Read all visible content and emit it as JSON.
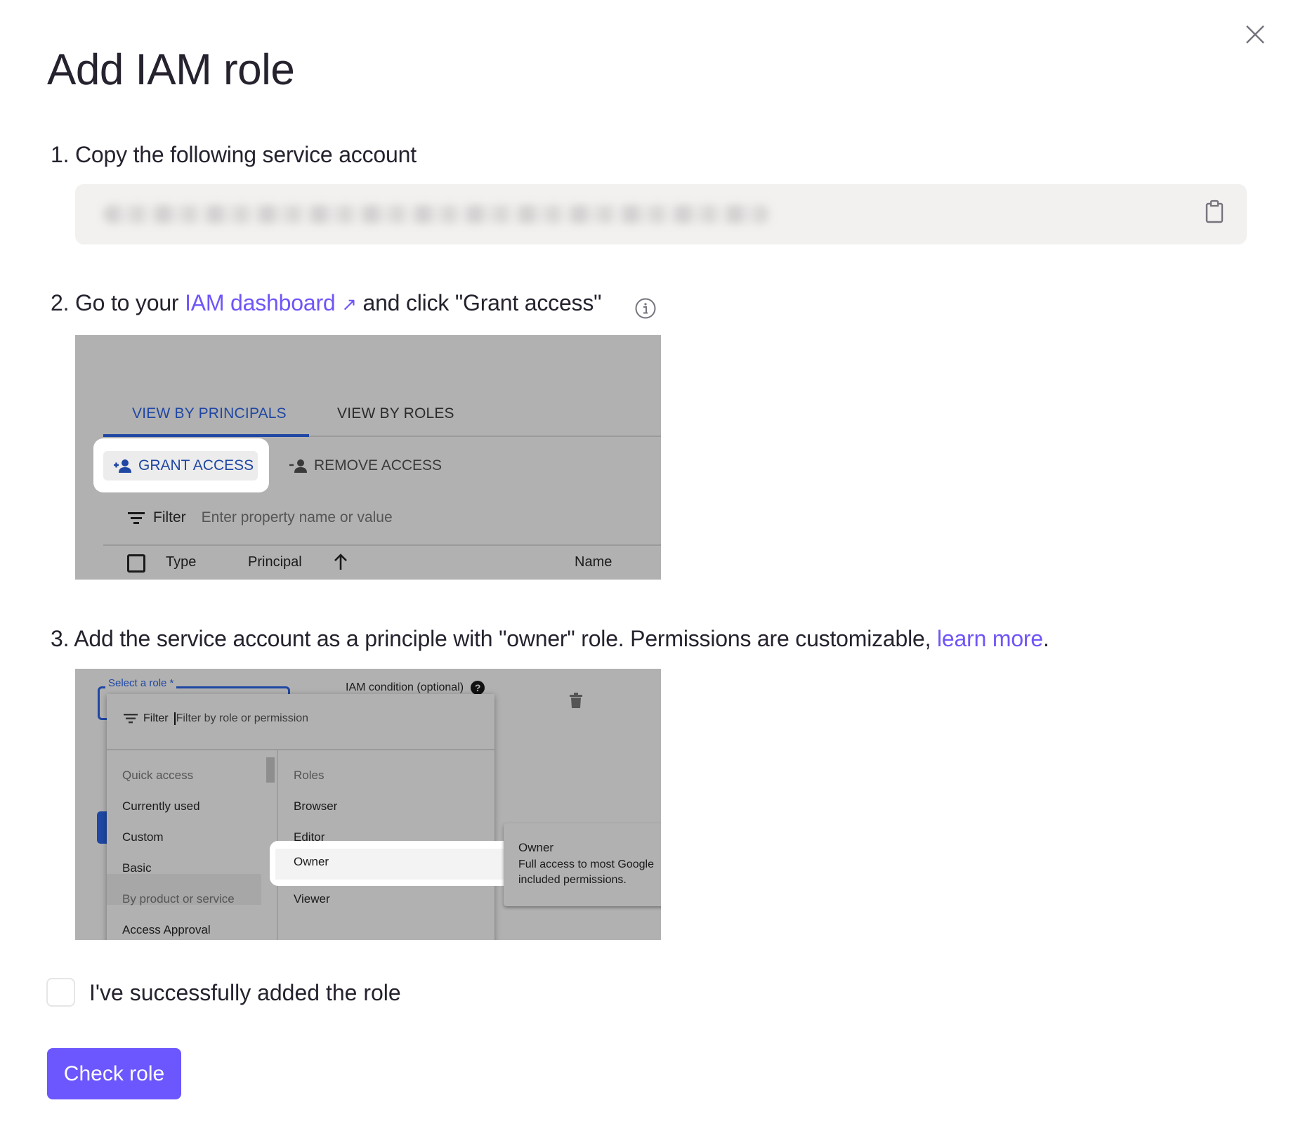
{
  "dialog": {
    "title": "Add IAM role",
    "close_icon": "close-icon"
  },
  "colors": {
    "accent": "#6b57fd",
    "link": "#6e56f8",
    "text": "#26222e",
    "gcp_blue": "#1f47a3"
  },
  "step1": {
    "text": "1. Copy the following service account",
    "service_account_value": "[blurred]",
    "copy_icon": "clipboard-icon"
  },
  "step2": {
    "prefix": "2. Go to your ",
    "link_text": "IAM dashboard",
    "link_icon": "↗",
    "suffix": " and click \"Grant access\"",
    "info_icon": "info-icon",
    "screenshot": {
      "tabs": [
        "VIEW BY PRINCIPALS",
        "VIEW BY ROLES"
      ],
      "active_tab": "VIEW BY PRINCIPALS",
      "grant_access_label": "GRANT ACCESS",
      "remove_access_label": "REMOVE ACCESS",
      "filter_label": "Filter",
      "filter_placeholder": "Enter property name or value",
      "columns": {
        "type": "Type",
        "principal": "Principal",
        "name": "Name"
      }
    }
  },
  "step3": {
    "prefix": "3. Add the service account as a principle with \"owner\" role. Permissions are customizable, ",
    "link_text": "learn more",
    "suffix": ".",
    "screenshot": {
      "select_label": "Select a role *",
      "iam_condition_label": "IAM condition (optional)",
      "filter_label": "Filter",
      "filter_placeholder": "Filter by role or permission",
      "left_column": [
        "Quick access",
        "Currently used",
        "Custom",
        "Basic",
        "By product or service",
        "Access Approval"
      ],
      "right_column": [
        "Roles",
        "Browser",
        "Editor",
        "Owner",
        "Viewer"
      ],
      "selected_category": "Basic",
      "selected_role": "Owner",
      "tooltip": {
        "title": "Owner",
        "line1": "Full access to most Google",
        "line2": "included permissions."
      }
    }
  },
  "confirm": {
    "checkbox_label": "I've successfully added the role",
    "checked": false
  },
  "actions": {
    "check_role_label": "Check role"
  }
}
